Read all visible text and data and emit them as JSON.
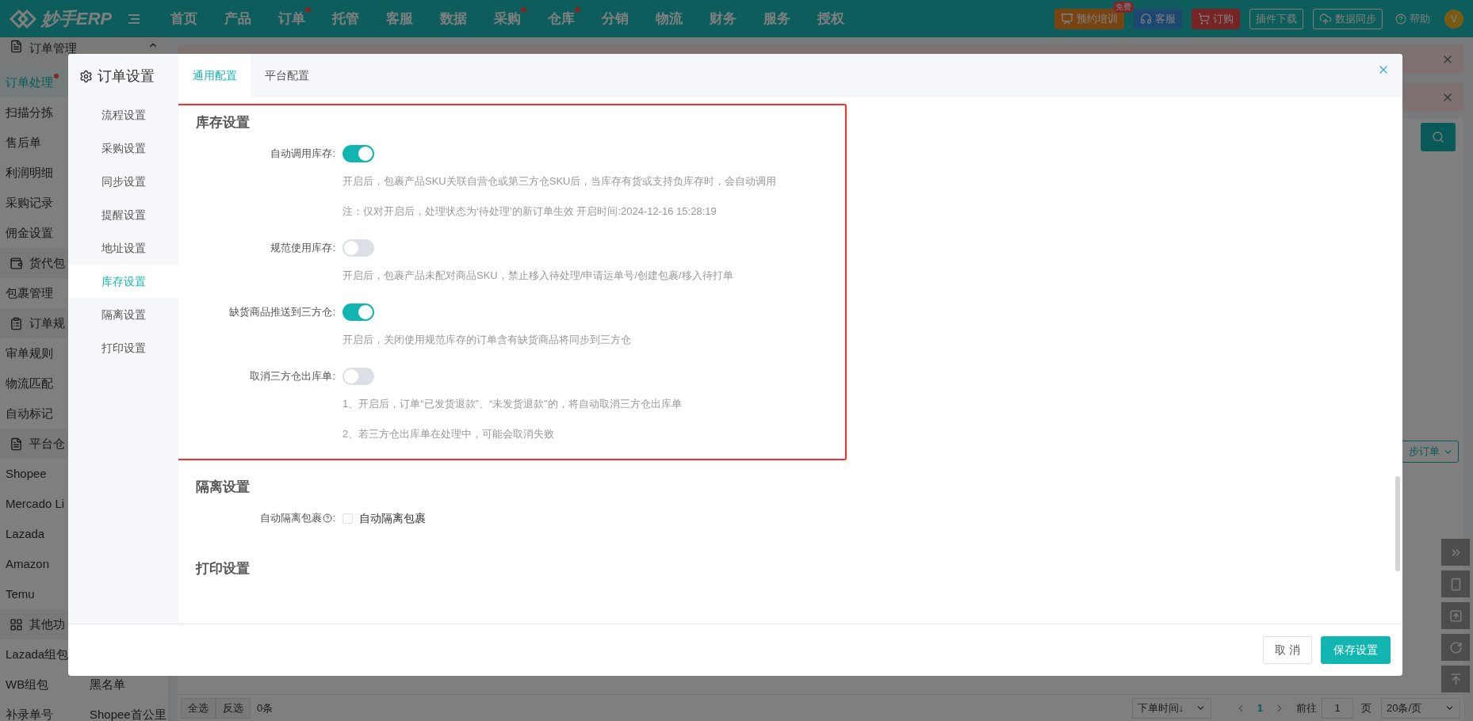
{
  "top_nav": {
    "logo": "妙手ERP",
    "items": [
      {
        "label": "首页",
        "dot": false
      },
      {
        "label": "产品",
        "dot": false
      },
      {
        "label": "订单",
        "dot": true
      },
      {
        "label": "托管",
        "dot": false
      },
      {
        "label": "客服",
        "dot": false
      },
      {
        "label": "数据",
        "dot": false
      },
      {
        "label": "采购",
        "dot": true
      },
      {
        "label": "仓库",
        "dot": true
      },
      {
        "label": "分销",
        "dot": false
      },
      {
        "label": "物流",
        "dot": false
      },
      {
        "label": "财务",
        "dot": false
      },
      {
        "label": "服务",
        "dot": false
      },
      {
        "label": "授权",
        "dot": false
      }
    ],
    "actions": [
      {
        "kind": "training",
        "label": "预约培训",
        "badge": "免费"
      },
      {
        "kind": "service",
        "label": "客服"
      },
      {
        "kind": "order",
        "label": "订购"
      },
      {
        "kind": "plain",
        "label": "插件下载"
      },
      {
        "kind": "sync",
        "label": "数据同步"
      }
    ],
    "help": "帮助",
    "avatar": "V"
  },
  "sidebar": {
    "groups": [
      {
        "title": "订单管理",
        "kind": "list",
        "items": [
          {
            "label": "订单处理",
            "selected": true,
            "dot": true
          },
          {
            "label": "扫描分拣",
            "selected": false,
            "dot": false
          },
          {
            "label": "售后单",
            "selected": false,
            "dot": false
          },
          {
            "label": "利润明细",
            "selected": false,
            "dot": false
          },
          {
            "label": "采购记录",
            "selected": false,
            "dot": false
          },
          {
            "label": "佣金设置",
            "selected": false,
            "dot": false
          }
        ]
      },
      {
        "title": "货代包",
        "kind": "list",
        "items": [
          {
            "label": "包裹管理",
            "selected": false,
            "dot": false
          }
        ]
      },
      {
        "title": "订单规",
        "kind": "list",
        "items": [
          {
            "label": "审单规则",
            "selected": false,
            "dot": false
          },
          {
            "label": "物流匹配",
            "selected": false,
            "dot": false
          },
          {
            "label": "自动标记",
            "selected": false,
            "dot": false
          }
        ]
      },
      {
        "title": "平台仓",
        "kind": "list",
        "items": [
          {
            "label": "Shopee",
            "selected": false,
            "dot": false
          },
          {
            "label": "Mercado Li",
            "selected": false,
            "dot": false
          },
          {
            "label": "Lazada",
            "selected": false,
            "dot": false
          },
          {
            "label": "Amazon",
            "selected": false,
            "dot": false
          },
          {
            "label": "Temu",
            "selected": false,
            "dot": false
          }
        ]
      },
      {
        "title": "其他功",
        "kind": "grid",
        "rows": [
          {
            "items": [
              {
                "label": "Lazada组包",
                "selected": false,
                "dot": false
              }
            ]
          },
          {
            "items": [
              {
                "label": "WB组包",
                "selected": false,
                "dot": false
              },
              {
                "label": "黑名单",
                "selected": false,
                "dot": false
              }
            ]
          },
          {
            "items": [
              {
                "label": "补录单号",
                "selected": false,
                "dot": false
              },
              {
                "label": "Shopee首公里",
                "selected": false,
                "dot": false
              }
            ]
          }
        ]
      }
    ]
  },
  "toolbar": {
    "sync_orders": "步订单"
  },
  "bottom_bar": {
    "select_all": "全选",
    "invert": "反选",
    "count": "0条",
    "sort": "下单时间↓",
    "page": "1",
    "goto_label": "前往",
    "goto_value": "1",
    "page_unit": "页",
    "page_size": "20条/页"
  },
  "modal": {
    "title": "订单设置",
    "nav": [
      {
        "label": "流程设置",
        "selected": false
      },
      {
        "label": "采购设置",
        "selected": false
      },
      {
        "label": "同步设置",
        "selected": false
      },
      {
        "label": "提醒设置",
        "selected": false
      },
      {
        "label": "地址设置",
        "selected": false
      },
      {
        "label": "库存设置",
        "selected": true
      },
      {
        "label": "隔离设置",
        "selected": false
      },
      {
        "label": "打印设置",
        "selected": false
      }
    ],
    "tabs": [
      {
        "label": "通用配置",
        "selected": true
      },
      {
        "label": "平台配置",
        "selected": false
      }
    ],
    "sections": [
      {
        "title": "库存设置",
        "highlighted": true,
        "settings": [
          {
            "kind": "switch",
            "label": "自动调用库存:",
            "on": true,
            "notes": [
              "开启后，包裹产品SKU关联自营仓或第三方仓SKU后，当库存有货或支持负库存时，会自动调用",
              "注：仅对开启后，处理状态为‘待处理’的新订单生效 开启时间:2024-12-16 15:28:19"
            ]
          },
          {
            "kind": "switch",
            "label": "规范使用库存:",
            "on": false,
            "notes": [
              "开启后，包裹产品未配对商品SKU，禁止移入待处理/申请运单号/创建包裹/移入待打单"
            ]
          },
          {
            "kind": "switch",
            "label": "缺货商品推送到三方仓:",
            "on": true,
            "notes": [
              "开启后，关闭使用规范库存的订单含有缺货商品将同步到三方仓"
            ]
          },
          {
            "kind": "switch",
            "label": "取消三方仓出库单:",
            "on": false,
            "notes": [
              "1、开启后，订单“已发货退款”、“未发货退款”的，将自动取消三方仓出库单",
              "2、若三方仓出库单在处理中，可能会取消失败"
            ]
          }
        ]
      },
      {
        "title": "隔离设置",
        "highlighted": false,
        "settings": [
          {
            "kind": "checkbox",
            "label": "自动隔离包裹",
            "suffix": ":",
            "checked": false,
            "option": "自动隔离包裹"
          }
        ]
      },
      {
        "title": "打印设置",
        "highlighted": false
      }
    ],
    "cancel": "取 消",
    "save": "保存设置"
  }
}
